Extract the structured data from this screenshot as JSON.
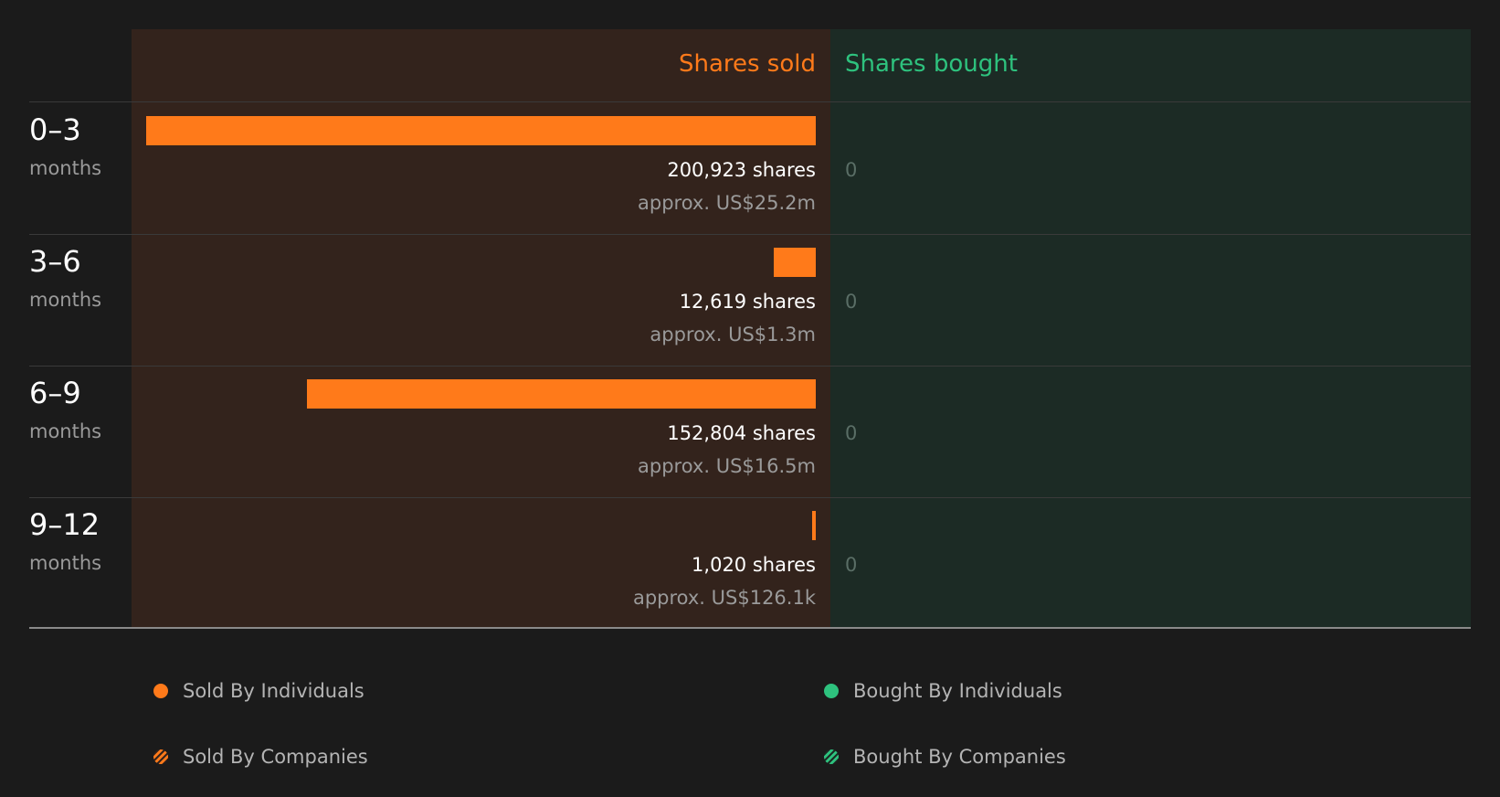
{
  "headers": {
    "sold": "Shares sold",
    "bought": "Shares bought"
  },
  "colors": {
    "sold": "#ff7a1a",
    "bought": "#2ec27e",
    "background": "#1b1b1b"
  },
  "rows": [
    {
      "period": "0–3",
      "unit": "months",
      "sold_label": "200,923 shares",
      "value_label": "approx. US$25.2m",
      "bought_label": "0"
    },
    {
      "period": "3–6",
      "unit": "months",
      "sold_label": "12,619 shares",
      "value_label": "approx. US$1.3m",
      "bought_label": "0"
    },
    {
      "period": "6–9",
      "unit": "months",
      "sold_label": "152,804 shares",
      "value_label": "approx. US$16.5m",
      "bought_label": "0"
    },
    {
      "period": "9–12",
      "unit": "months",
      "sold_label": "1,020 shares",
      "value_label": "approx. US$126.1k",
      "bought_label": "0"
    }
  ],
  "legend": [
    {
      "label": "Sold By Individuals",
      "icon": "solid-orange-dot-icon"
    },
    {
      "label": "Bought By Individuals",
      "icon": "solid-green-dot-icon"
    },
    {
      "label": "Sold By Companies",
      "icon": "striped-orange-dot-icon"
    },
    {
      "label": "Bought By Companies",
      "icon": "striped-green-dot-icon"
    }
  ],
  "chart_data": {
    "type": "bar",
    "categories": [
      "0–3 months",
      "3–6 months",
      "6–9 months",
      "9–12 months"
    ],
    "series": [
      {
        "name": "Shares sold",
        "values": [
          200923,
          12619,
          152804,
          1020
        ]
      },
      {
        "name": "Shares bought",
        "values": [
          0,
          0,
          0,
          0
        ]
      }
    ],
    "value_usd": [
      "approx. US$25.2m",
      "approx. US$1.3m",
      "approx. US$16.5m",
      "approx. US$126.1k"
    ],
    "orientation": "horizontal-diverging",
    "legend_position": "bottom",
    "grid": false
  }
}
